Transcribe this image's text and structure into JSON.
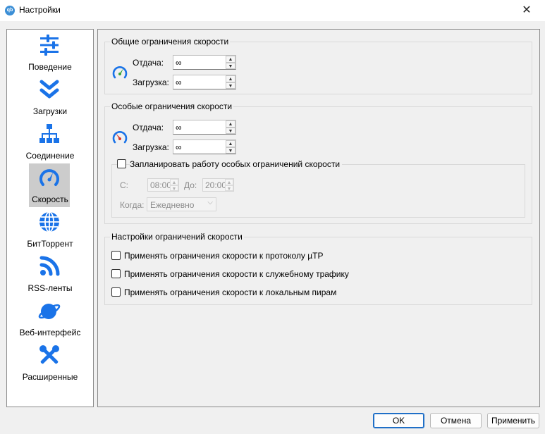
{
  "window": {
    "title": "Настройки",
    "app_icon_text": "qb",
    "close_glyph": "✕"
  },
  "colors": {
    "accent": "#1a73e8",
    "sidebar_active": "#cccccc",
    "gauge_green": "#3aa53a",
    "gauge_red": "#d9342b"
  },
  "sidebar": {
    "items": [
      {
        "label": "Поведение",
        "icon": "sliders-icon"
      },
      {
        "label": "Загрузки",
        "icon": "double-chevron-down-icon"
      },
      {
        "label": "Соединение",
        "icon": "network-icon"
      },
      {
        "label": "Скорость",
        "icon": "speedometer-icon",
        "active": true
      },
      {
        "label": "БитТоррент",
        "icon": "globe-icon"
      },
      {
        "label": "RSS-ленты",
        "icon": "rss-icon"
      },
      {
        "label": "Веб-интерфейс",
        "icon": "planet-icon"
      },
      {
        "label": "Расширенные",
        "icon": "tools-icon"
      }
    ]
  },
  "global_limits": {
    "title": "Общие ограничения скорости",
    "upload_label": "Отдача:",
    "upload_value": "∞",
    "download_label": "Загрузка:",
    "download_value": "∞"
  },
  "alt_limits": {
    "title": "Особые ограничения скорости",
    "upload_label": "Отдача:",
    "upload_value": "∞",
    "download_label": "Загрузка:",
    "download_value": "∞",
    "schedule": {
      "checkbox_label": "Запланировать работу особых ограничений скорости",
      "checked": false,
      "from_label": "С:",
      "from_value": "08:00",
      "to_label": "До:",
      "to_value": "20:00",
      "when_label": "Когда:",
      "when_value": "Ежедневно"
    }
  },
  "limit_settings": {
    "title": "Настройки ограничений скорости",
    "options": [
      {
        "label": "Применять ограничения скорости к протоколу µTP",
        "checked": false
      },
      {
        "label": "Применять ограничения скорости к служебному трафику",
        "checked": false
      },
      {
        "label": "Применять ограничения скорости к локальным пирам",
        "checked": false
      }
    ]
  },
  "buttons": {
    "ok": "OK",
    "cancel": "Отмена",
    "apply": "Применить"
  }
}
